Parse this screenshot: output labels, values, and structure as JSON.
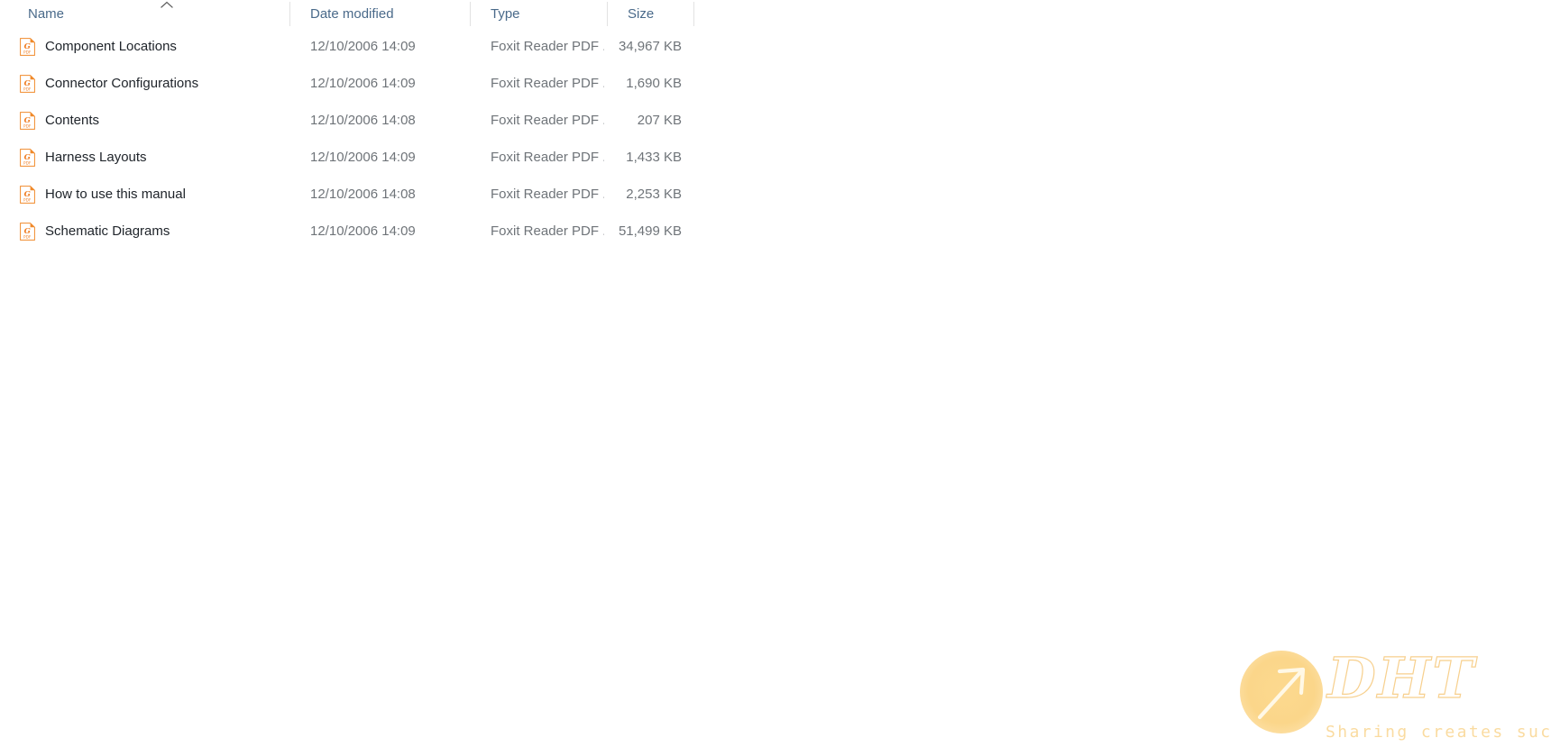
{
  "window": {
    "view_mode": "details"
  },
  "columns": {
    "headers": [
      {
        "key": "name",
        "label": "Name",
        "sorted": true,
        "sort_direction": "ascending",
        "sort_icon": "chevron-up-icon"
      },
      {
        "key": "date_modified",
        "label": "Date modified",
        "sorted": false
      },
      {
        "key": "type",
        "label": "Type",
        "sorted": false
      },
      {
        "key": "size",
        "label": "Size",
        "sorted": false
      }
    ]
  },
  "files": [
    {
      "name": "Component Locations",
      "date_modified": "12/10/2006 14:09",
      "type": "Foxit Reader PDF ...",
      "size": "34,967 KB",
      "icon": "pdf-file-icon"
    },
    {
      "name": "Connector Configurations",
      "date_modified": "12/10/2006 14:09",
      "type": "Foxit Reader PDF ...",
      "size": "1,690 KB",
      "icon": "pdf-file-icon"
    },
    {
      "name": "Contents",
      "date_modified": "12/10/2006 14:08",
      "type": "Foxit Reader PDF ...",
      "size": "207 KB",
      "icon": "pdf-file-icon"
    },
    {
      "name": "Harness Layouts",
      "date_modified": "12/10/2006 14:09",
      "type": "Foxit Reader PDF ...",
      "size": "1,433 KB",
      "icon": "pdf-file-icon"
    },
    {
      "name": "How to use this manual",
      "date_modified": "12/10/2006 14:08",
      "type": "Foxit Reader PDF ...",
      "size": "2,253 KB",
      "icon": "pdf-file-icon"
    },
    {
      "name": "Schematic Diagrams",
      "date_modified": "12/10/2006 14:09",
      "type": "Foxit Reader PDF ...",
      "size": "51,499 KB",
      "icon": "pdf-file-icon"
    }
  ],
  "watermark": {
    "brand": "DHT",
    "tagline": "Sharing creates success",
    "logo_icon": "arrow-up-right-circle-icon",
    "colors": {
      "circle": "#fbd68a",
      "outline": "#f7d08e",
      "tagline": "#fadba0"
    }
  },
  "colors": {
    "header_text": "#4a6a8a",
    "row_text": "#20252b",
    "meta_text": "#6f7479",
    "divider": "#e2e2e2",
    "pdf_accent": "#ef7d23",
    "background": "#ffffff"
  }
}
